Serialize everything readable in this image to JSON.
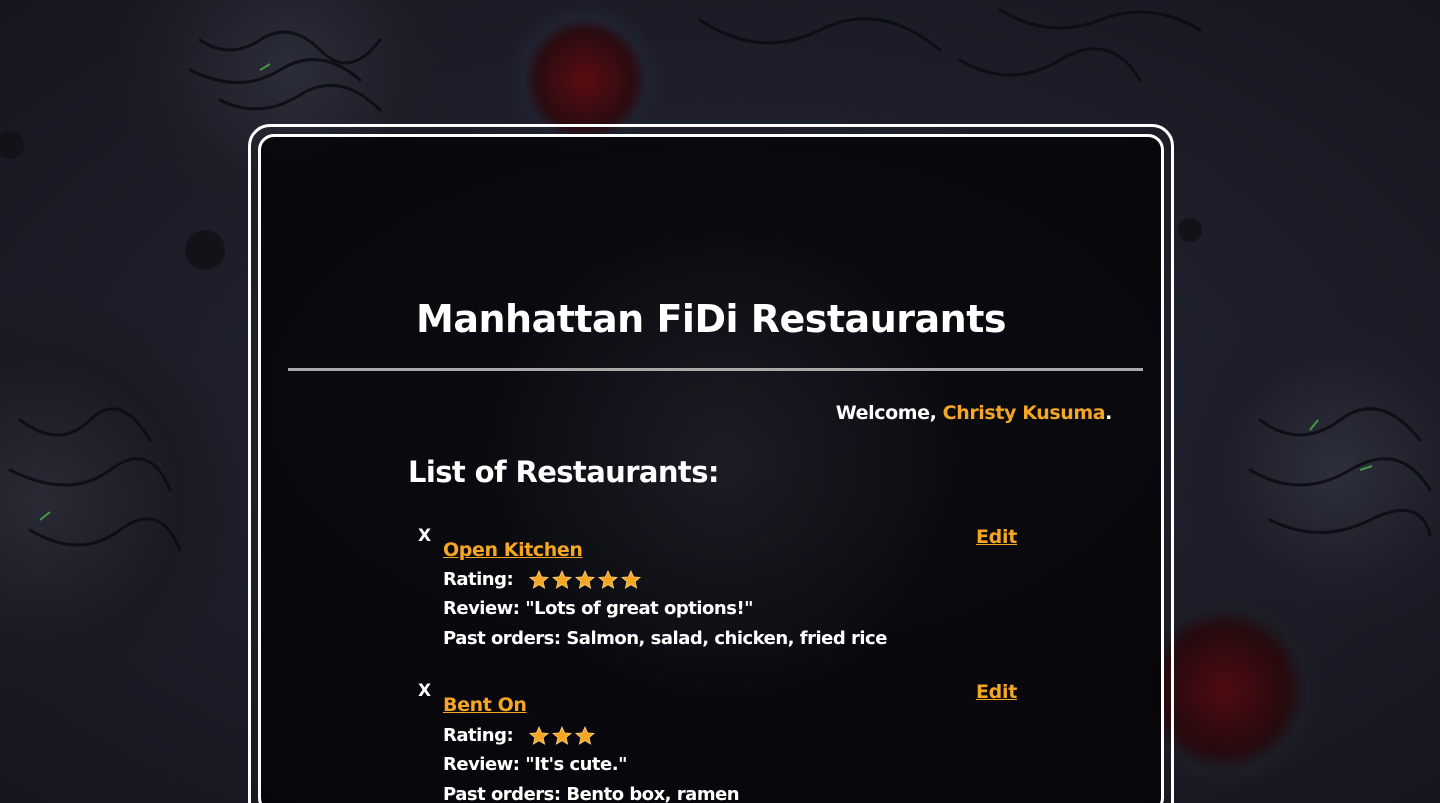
{
  "page": {
    "title": "Manhattan FiDi Restaurants",
    "welcome_prefix": "Welcome, ",
    "user_name": "Christy Kusuma",
    "welcome_suffix": ".",
    "list_heading": "List of Restaurants:"
  },
  "labels": {
    "delete": "X",
    "edit": "Edit",
    "rating": "Rating:",
    "review_prefix": "Review: ",
    "orders_prefix": "Past orders: "
  },
  "colors": {
    "accent": "#f5a623",
    "text": "#ffffff",
    "divider": "#a9a9a9"
  },
  "icons": {
    "star": "star-icon"
  },
  "restaurants": [
    {
      "name": "Open Kitchen",
      "rating": 5,
      "review": "\"Lots of great options!\"",
      "past_orders": "Salmon, salad, chicken, fried rice"
    },
    {
      "name": "Bent On",
      "rating": 3,
      "review": "\"It's cute.\"",
      "past_orders": "Bento box, ramen"
    }
  ]
}
